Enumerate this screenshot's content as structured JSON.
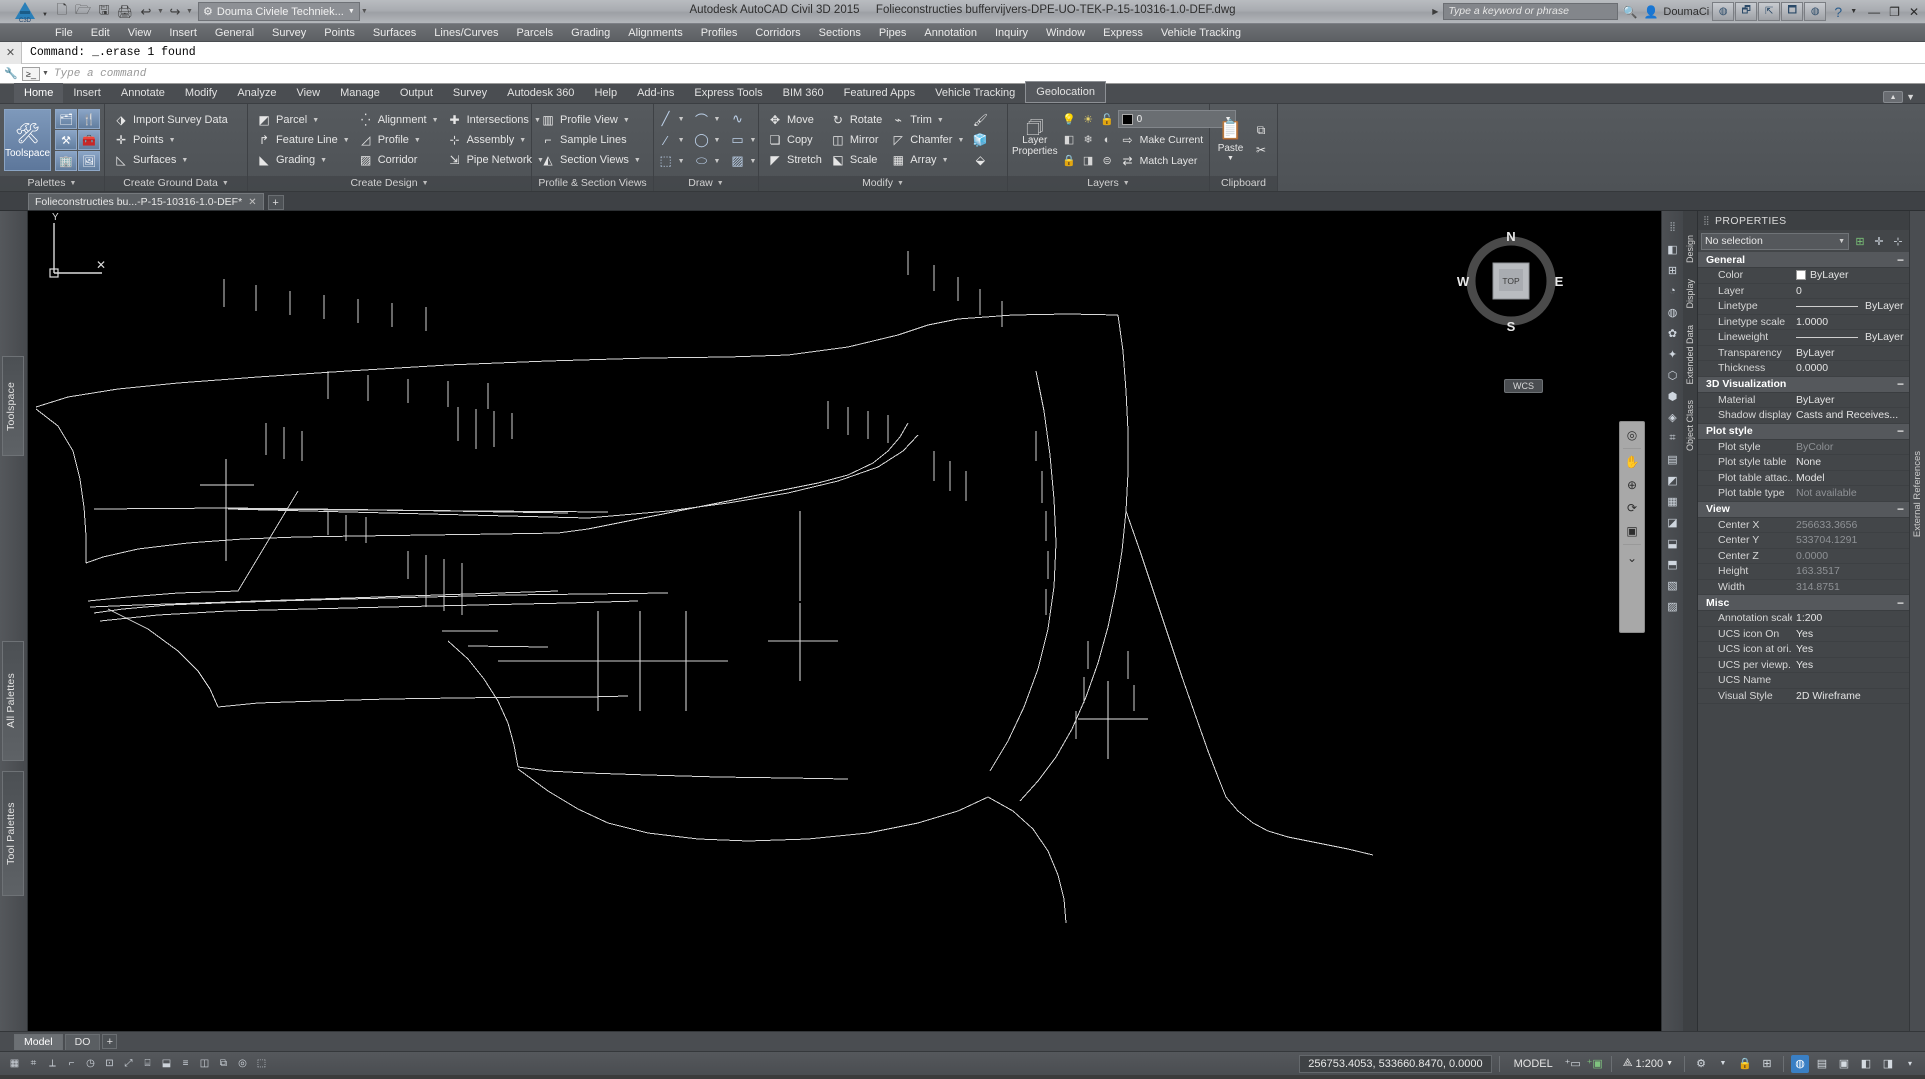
{
  "titlebar": {
    "app_menu": "C3D",
    "quick_access": [
      {
        "name": "new-icon",
        "glyph": "🗋"
      },
      {
        "name": "open-icon",
        "glyph": "🗁"
      },
      {
        "name": "save-icon",
        "glyph": "🖫"
      },
      {
        "name": "plot-icon",
        "glyph": "🖨"
      },
      {
        "name": "undo-icon",
        "glyph": "↩"
      },
      {
        "name": "redo-icon",
        "glyph": "↪"
      }
    ],
    "workspace": "Douma Civiele Techniek...",
    "product": "Autodesk AutoCAD Civil 3D 2015",
    "document": "Folieconstructies buffervijvers-DPE-UO-TEK-P-15-10316-1.0-DEF.dwg",
    "search_placeholder": "Type a keyword or phrase",
    "sign_in": "DoumaCi",
    "help_label": "?",
    "window_minimize": "—",
    "window_restore": "❐",
    "window_close": "✕"
  },
  "menubar": [
    "File",
    "Edit",
    "View",
    "Insert",
    "General",
    "Survey",
    "Points",
    "Surfaces",
    "Lines/Curves",
    "Parcels",
    "Grading",
    "Alignments",
    "Profiles",
    "Corridors",
    "Sections",
    "Pipes",
    "Annotation",
    "Inquiry",
    "Window",
    "Express",
    "Vehicle Tracking"
  ],
  "command_history": "Command: _.erase 1 found",
  "command_input": {
    "placeholder": "Type a command",
    "prompt_glyph": "≥_"
  },
  "ribbon_tabs": {
    "items": [
      "Home",
      "Insert",
      "Annotate",
      "Modify",
      "Analyze",
      "View",
      "Manage",
      "Output",
      "Survey",
      "Autodesk 360",
      "Help",
      "Add-ins",
      "Express Tools",
      "BIM 360",
      "Featured Apps",
      "Vehicle Tracking",
      "Geolocation"
    ],
    "active": "Home",
    "outlined": "Geolocation"
  },
  "ribbon": {
    "panels": [
      {
        "title": "Palettes",
        "big_button": "Toolspace",
        "grid_icons": [
          "🗂",
          "🛠",
          "⚒",
          "🧰",
          "🏢",
          "🖼"
        ]
      },
      {
        "title": "Create Ground Data",
        "items": [
          {
            "label": "Import Survey Data",
            "icon": "⬗",
            "dropdown": false
          },
          {
            "label": "Points",
            "icon": "✛",
            "dropdown": true
          },
          {
            "label": "Surfaces",
            "icon": "◺",
            "dropdown": true
          }
        ]
      },
      {
        "title": "Create Design",
        "columns": [
          [
            {
              "label": "Parcel",
              "icon": "◩",
              "dropdown": true
            },
            {
              "label": "Feature Line",
              "icon": "↱",
              "dropdown": true
            },
            {
              "label": "Grading",
              "icon": "◣",
              "dropdown": true
            }
          ],
          [
            {
              "label": "Alignment",
              "icon": "⁚",
              "dropdown": true
            },
            {
              "label": "Profile",
              "icon": "◿",
              "dropdown": true
            },
            {
              "label": "Corridor",
              "icon": "🛣",
              "dropdown": false
            }
          ],
          [
            {
              "label": "Intersections",
              "icon": "✚",
              "dropdown": true
            },
            {
              "label": "Assembly",
              "icon": "⊹",
              "dropdown": true
            },
            {
              "label": "Pipe Network",
              "icon": "⇲",
              "dropdown": true
            }
          ]
        ]
      },
      {
        "title": "Profile & Section Views",
        "items": [
          {
            "label": "Profile View",
            "icon": "📈",
            "dropdown": true
          },
          {
            "label": "Sample Lines",
            "icon": "⌐",
            "dropdown": false
          },
          {
            "label": "Section Views",
            "icon": "▥",
            "dropdown": true
          }
        ]
      },
      {
        "title": "Draw",
        "cells": [
          {
            "name": "line-tool",
            "icon": "╱",
            "dropdown": true
          },
          {
            "name": "polyline-tool",
            "icon": "⌒",
            "dropdown": true
          },
          {
            "name": "spline-tool",
            "icon": "∿",
            "dropdown": false
          },
          {
            "name": "construction-line-tool",
            "icon": "⁄",
            "dropdown": true
          },
          {
            "name": "circle-tool",
            "icon": "◯",
            "dropdown": true
          },
          {
            "name": "rectangle-tool",
            "icon": "▭",
            "dropdown": true
          },
          {
            "name": "hatch-boundary-tool",
            "icon": "⬚",
            "dropdown": true
          },
          {
            "name": "ellipse-tool",
            "icon": "⬭",
            "dropdown": true
          },
          {
            "name": "gradient-tool",
            "icon": "▨",
            "dropdown": true
          }
        ]
      },
      {
        "title": "Modify",
        "columns": [
          [
            {
              "label": "Move",
              "icon": "✥"
            },
            {
              "label": "Copy",
              "icon": "❏"
            },
            {
              "label": "Stretch",
              "icon": "◤"
            }
          ],
          [
            {
              "label": "Rotate",
              "icon": "↻"
            },
            {
              "label": "Mirror",
              "icon": "◫"
            },
            {
              "label": "Scale",
              "icon": "⬕"
            }
          ],
          [
            {
              "label": "Trim",
              "icon": "⌁",
              "dropdown": true
            },
            {
              "label": "Chamfer",
              "icon": "◸",
              "dropdown": true
            },
            {
              "label": "Array",
              "icon": "▦",
              "dropdown": true
            }
          ],
          [
            {
              "label": "",
              "icon": "🖌"
            },
            {
              "label": "",
              "icon": "🧊"
            },
            {
              "label": "",
              "icon": "⬙"
            }
          ]
        ]
      },
      {
        "title": "Layers",
        "big_button": "Layer Properties",
        "layer_combo_value": "0",
        "right_items": [
          {
            "label": "Make Current",
            "icon": "⇨"
          },
          {
            "label": "Match Layer",
            "icon": "⇄"
          }
        ]
      },
      {
        "title": "Clipboard",
        "big_button": "Paste"
      }
    ]
  },
  "document_tabs": {
    "items": [
      {
        "label": "Folieconstructies bu...-P-15-10316-1.0-DEF*",
        "close": "✕"
      }
    ],
    "add": "+"
  },
  "left_rail": [
    {
      "name": "rail-toolspace",
      "label": "Toolspace"
    },
    {
      "name": "rail-allpalettes",
      "label": "All Palettes"
    },
    {
      "name": "rail-toolpalettes",
      "label": "Tool Palettes"
    }
  ],
  "viewcube": {
    "top": "TOP",
    "north": "N",
    "south": "S",
    "east": "E",
    "west": "W",
    "ucs": "WCS"
  },
  "navbar_icons": [
    "☰",
    "⊙",
    "✋",
    "⟳",
    "⊕",
    "◎",
    "▣",
    "⬚"
  ],
  "right_strip_icons": [
    "◧",
    "⊞",
    "◔",
    "◍",
    "✿",
    "✦",
    "⬡",
    "⬢",
    "◈",
    "⌗",
    "▤",
    "◩",
    "▦",
    "◪",
    "⬓",
    "⬒",
    "▧",
    "▨"
  ],
  "right_vtabs": [
    "External References"
  ],
  "properties": {
    "title": "PROPERTIES",
    "selection": "No selection",
    "toolbar_icons": [
      "quick-select-icon",
      "pick-point-icon",
      "toggle-value-icon"
    ],
    "side_tabs": [
      "Design",
      "Display",
      "Extended Data",
      "Object Class"
    ],
    "sections": [
      {
        "name": "General",
        "collapsed_glyph": "−",
        "rows": [
          {
            "key": "Color",
            "value": "ByLayer",
            "swatch": "#ffffff",
            "readonly": false
          },
          {
            "key": "Layer",
            "value": "0",
            "readonly": false
          },
          {
            "key": "Linetype",
            "value": "ByLayer",
            "line": true,
            "readonly": false
          },
          {
            "key": "Linetype scale",
            "value": "1.0000",
            "readonly": false
          },
          {
            "key": "Lineweight",
            "value": "ByLayer",
            "line": true,
            "readonly": false
          },
          {
            "key": "Transparency",
            "value": "ByLayer",
            "readonly": false
          },
          {
            "key": "Thickness",
            "value": "0.0000",
            "readonly": false
          }
        ]
      },
      {
        "name": "3D Visualization",
        "collapsed_glyph": "−",
        "rows": [
          {
            "key": "Material",
            "value": "ByLayer",
            "readonly": false
          },
          {
            "key": "Shadow display",
            "value": "Casts and Receives...",
            "readonly": false
          }
        ]
      },
      {
        "name": "Plot style",
        "collapsed_glyph": "−",
        "rows": [
          {
            "key": "Plot style",
            "value": "ByColor",
            "readonly": true
          },
          {
            "key": "Plot style table",
            "value": "None",
            "readonly": false
          },
          {
            "key": "Plot table attac...",
            "value": "Model",
            "readonly": false
          },
          {
            "key": "Plot table type",
            "value": "Not available",
            "readonly": true
          }
        ]
      },
      {
        "name": "View",
        "collapsed_glyph": "−",
        "rows": [
          {
            "key": "Center X",
            "value": "256633.3656",
            "readonly": true
          },
          {
            "key": "Center Y",
            "value": "533704.1291",
            "readonly": true
          },
          {
            "key": "Center Z",
            "value": "0.0000",
            "readonly": true
          },
          {
            "key": "Height",
            "value": "163.3517",
            "readonly": true
          },
          {
            "key": "Width",
            "value": "314.8751",
            "readonly": true
          }
        ]
      },
      {
        "name": "Misc",
        "collapsed_glyph": "−",
        "rows": [
          {
            "key": "Annotation scale",
            "value": "1:200",
            "readonly": false
          },
          {
            "key": "UCS icon On",
            "value": "Yes",
            "readonly": false
          },
          {
            "key": "UCS icon at ori...",
            "value": "Yes",
            "readonly": false
          },
          {
            "key": "UCS per viewp...",
            "value": "Yes",
            "readonly": false
          },
          {
            "key": "UCS Name",
            "value": "",
            "readonly": false
          },
          {
            "key": "Visual Style",
            "value": "2D Wireframe",
            "readonly": false
          }
        ]
      }
    ]
  },
  "bottom_tabs": {
    "items": [
      "Model",
      "DO"
    ],
    "active": "Model",
    "add": "+"
  },
  "statusbar": {
    "coordinates": "256753.4053, 533660.8470, 0.0000",
    "space": "MODEL",
    "annotation_scale": "1:200",
    "left_icons": [
      "grid-icon",
      "snap-icon",
      "infer-icon",
      "ortho-icon",
      "polar-icon",
      "osnap-icon",
      "otrack-icon",
      "ducs-icon",
      "dyn-icon",
      "lwt-icon",
      "transparency-icon",
      "qp-icon",
      "sc-icon",
      "am-icon"
    ],
    "right_icons": [
      "annotation-visibility-icon",
      "auto-scale-icon",
      "workspace-icon",
      "lock-icon",
      "hardware-icon",
      "clean-screen-icon",
      "isolate-icon",
      "fullscreen-icon"
    ]
  },
  "ucs_axis": {
    "y_label": "Y",
    "origin_marker": "✕"
  },
  "colors": {
    "accent": "#3a7fc4",
    "canvas_bg": "#000000",
    "geometry": "#d8d8d8",
    "ribbon_bg": "#4e5256",
    "panel_bg": "#434649"
  }
}
